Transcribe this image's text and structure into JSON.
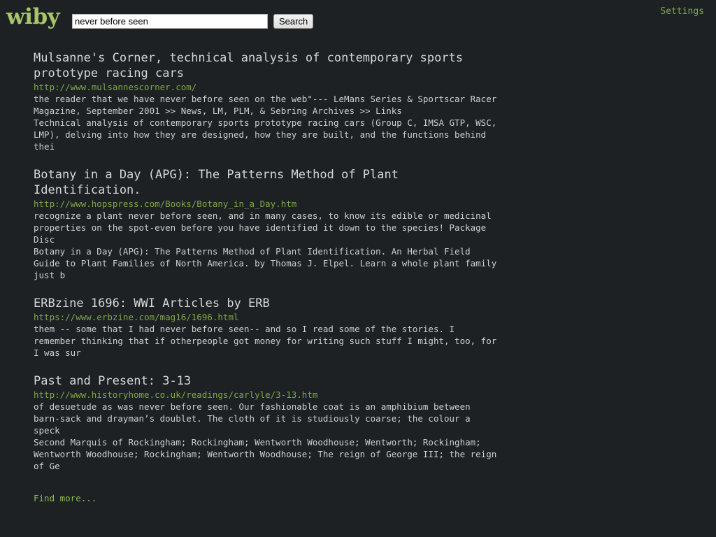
{
  "site": {
    "logo_text": "wiby",
    "logo_color": "#a9c46c",
    "background_color": "#1d2123",
    "link_color": "#7fa84a",
    "text_color": "#cfcfcf"
  },
  "header": {
    "search_value": "never before seen",
    "search_placeholder": "",
    "search_button_label": "Search",
    "settings_label": "Settings"
  },
  "results": [
    {
      "title": "Mulsanne's Corner, technical analysis of contemporary sports prototype racing cars",
      "url": "http://www.mulsannescorner.com/",
      "snippet": "the reader that we have never before seen on the web\"--- LeMans Series & Sportscar Racer\nMagazine, September 2001 >> News, LM, PLM, & Sebring Archives >> Links\nTechnical analysis of contemporary sports prototype racing cars (Group C, IMSA GTP, WSC,\nLMP), delving into how they are designed, how they are built, and the functions behind\nthei"
    },
    {
      "title": "Botany in a Day (APG): The Patterns Method of Plant Identification.",
      "url": "http://www.hopspress.com/Books/Botany_in_a_Day.htm",
      "snippet": "recognize a plant never before seen, and in many cases, to know its edible or medicinal\nproperties on the spot-even before you have identified it down to the species! Package\nDisc\nBotany in a Day (APG): The Patterns Method of Plant Identification. An Herbal Field\nGuide to Plant Families of North America. by Thomas J. Elpel. Learn a whole plant family\njust b"
    },
    {
      "title": "ERBzine 1696: WWI Articles by ERB",
      "url": "https://www.erbzine.com/mag16/1696.html",
      "snippet": "them -- some that I had never before seen-- and so I read some of the stories. I\nremember thinking that if otherpeople got money for writing such stuff I might, too, for\nI was sur"
    },
    {
      "title": "Past and Present: 3-13",
      "url": "http://www.historyhome.co.uk/readings/carlyle/3-13.htm",
      "snippet": "of desuetude as was never before seen. Our fashionable coat is an amphibium between\nbarn-sack and drayman’s doublet. The cloth of it is studiously coarse; the colour a\nspeck\nSecond Marquis of Rockingham; Rockingham; Wentworth Woodhouse; Wentworth; Rockingham;\nWentworth Woodhouse; Rockingham; Wentworth Woodhouse; The reign of George III; the reign\nof Ge"
    }
  ],
  "footer": {
    "find_more_label": "Find more..."
  }
}
